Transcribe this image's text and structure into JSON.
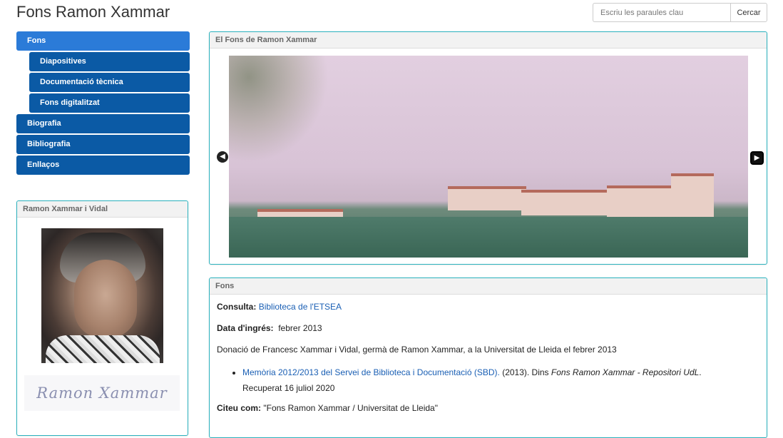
{
  "header": {
    "title": "Fons Ramon Xammar"
  },
  "search": {
    "placeholder": "Escriu les paraules clau",
    "button_label": "Cercar"
  },
  "nav": {
    "fons": "Fons",
    "diapositives": "Diapositives",
    "documentacio": "Documentació tècnica",
    "digitalitzat": "Fons digitalitzat",
    "biografia": "Biografia",
    "bibliografia": "Bibliografia",
    "enllacos": "Enllaços"
  },
  "profile": {
    "heading": "Ramon Xammar i Vidal",
    "signature": "Ramon Xammar"
  },
  "carousel": {
    "heading": "El Fons de Ramon Xammar",
    "prev_icon": "chevron-left-icon",
    "next_icon": "chevron-right-icon"
  },
  "fons": {
    "heading": "Fons",
    "consulta_label": "Consulta:",
    "consulta_link": "Biblioteca de l'ETSEA",
    "data_label": "Data d'ingrés:",
    "data_value": "febrer 2013",
    "donacio": "Donació de Francesc Xammar i Vidal, germà de Ramon Xammar, a la Universitat de Lleida el febrer 2013",
    "ref_link": "Memòria 2012/2013 del Servei de Biblioteca i Documentació (SBD).",
    "ref_year": " (2013). Dins ",
    "ref_source": "Fons Ramon Xammar - Repositori UdL",
    "ref_end": ".",
    "ref_recuperat": "Recuperat 16 juliol 2020",
    "citeu_label": "Citeu com:",
    "citeu_value": "\"Fons Ramon Xammar / Universitat de Lleida\""
  },
  "colors": {
    "nav": "#0b5aa5",
    "nav_active": "#2b7bd8",
    "panel_border": "#2ab1bd",
    "link": "#1a5fb4"
  }
}
